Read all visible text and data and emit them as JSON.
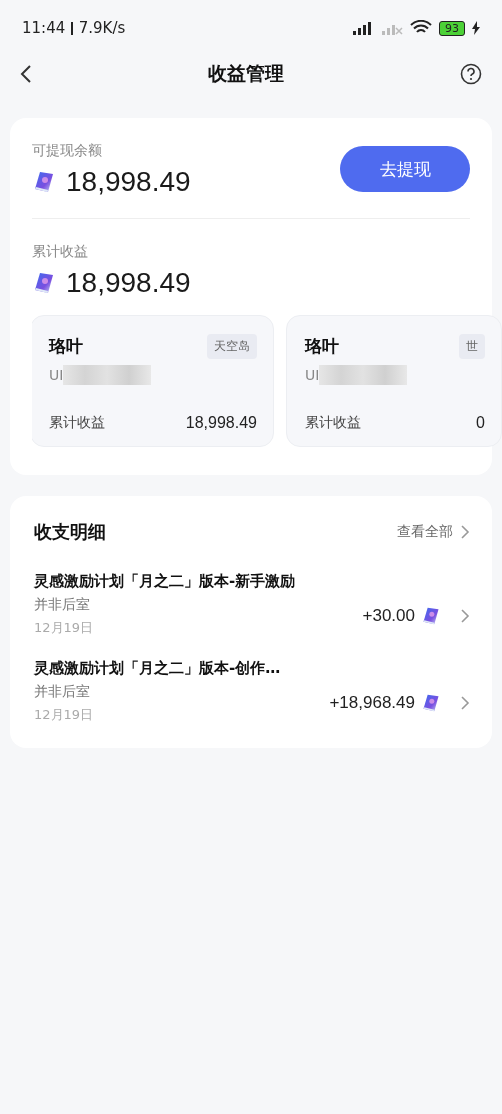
{
  "status_bar": {
    "time": "11:44",
    "speed": "7.9K/s",
    "battery": "93"
  },
  "nav": {
    "title": "收益管理"
  },
  "balance": {
    "label": "可提现余额",
    "amount": "18,998.49",
    "button": "去提现"
  },
  "total": {
    "label": "累计收益",
    "amount": "18,998.49"
  },
  "accounts": [
    {
      "name": "珞叶",
      "tag": "天空岛",
      "uid": "UI",
      "earn_label": "累计收益",
      "earn": "18,998.49"
    },
    {
      "name": "珞叶",
      "tag": "世",
      "uid": "UI",
      "earn_label": "累计收益",
      "earn": "0"
    }
  ],
  "details": {
    "title": "收支明细",
    "view_all": "查看全部",
    "rows": [
      {
        "title": "灵感激励计划「月之二」版本-新手激励",
        "source": "并非后室",
        "date": "12月19日",
        "amount": "+30.00"
      },
      {
        "title": "灵感激励计划「月之二」版本-创作…",
        "source": "并非后室",
        "date": "12月19日",
        "amount": "+18,968.49"
      }
    ]
  }
}
